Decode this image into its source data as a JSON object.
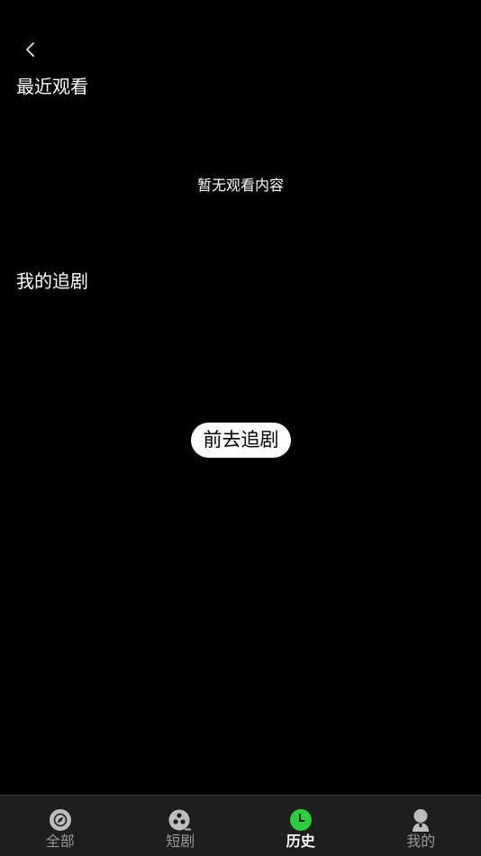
{
  "colors": {
    "background": "#000000",
    "tabbar_background": "#1e1e1e",
    "active_accent": "#2ecc40",
    "inactive_icon": "#bdbdbd",
    "inactive_label": "#9a9a9a"
  },
  "header": {
    "back_icon": "chevron-left-icon"
  },
  "recent": {
    "title": "最近观看",
    "empty_text": "暂无观看内容"
  },
  "follow": {
    "title": "我的追剧",
    "button_label": "前去追剧"
  },
  "tabbar": {
    "active_index": 2,
    "items": [
      {
        "label": "全部",
        "icon": "compass-icon"
      },
      {
        "label": "短剧",
        "icon": "film-reel-icon"
      },
      {
        "label": "历史",
        "icon": "clock-icon"
      },
      {
        "label": "我的",
        "icon": "user-icon"
      }
    ]
  }
}
